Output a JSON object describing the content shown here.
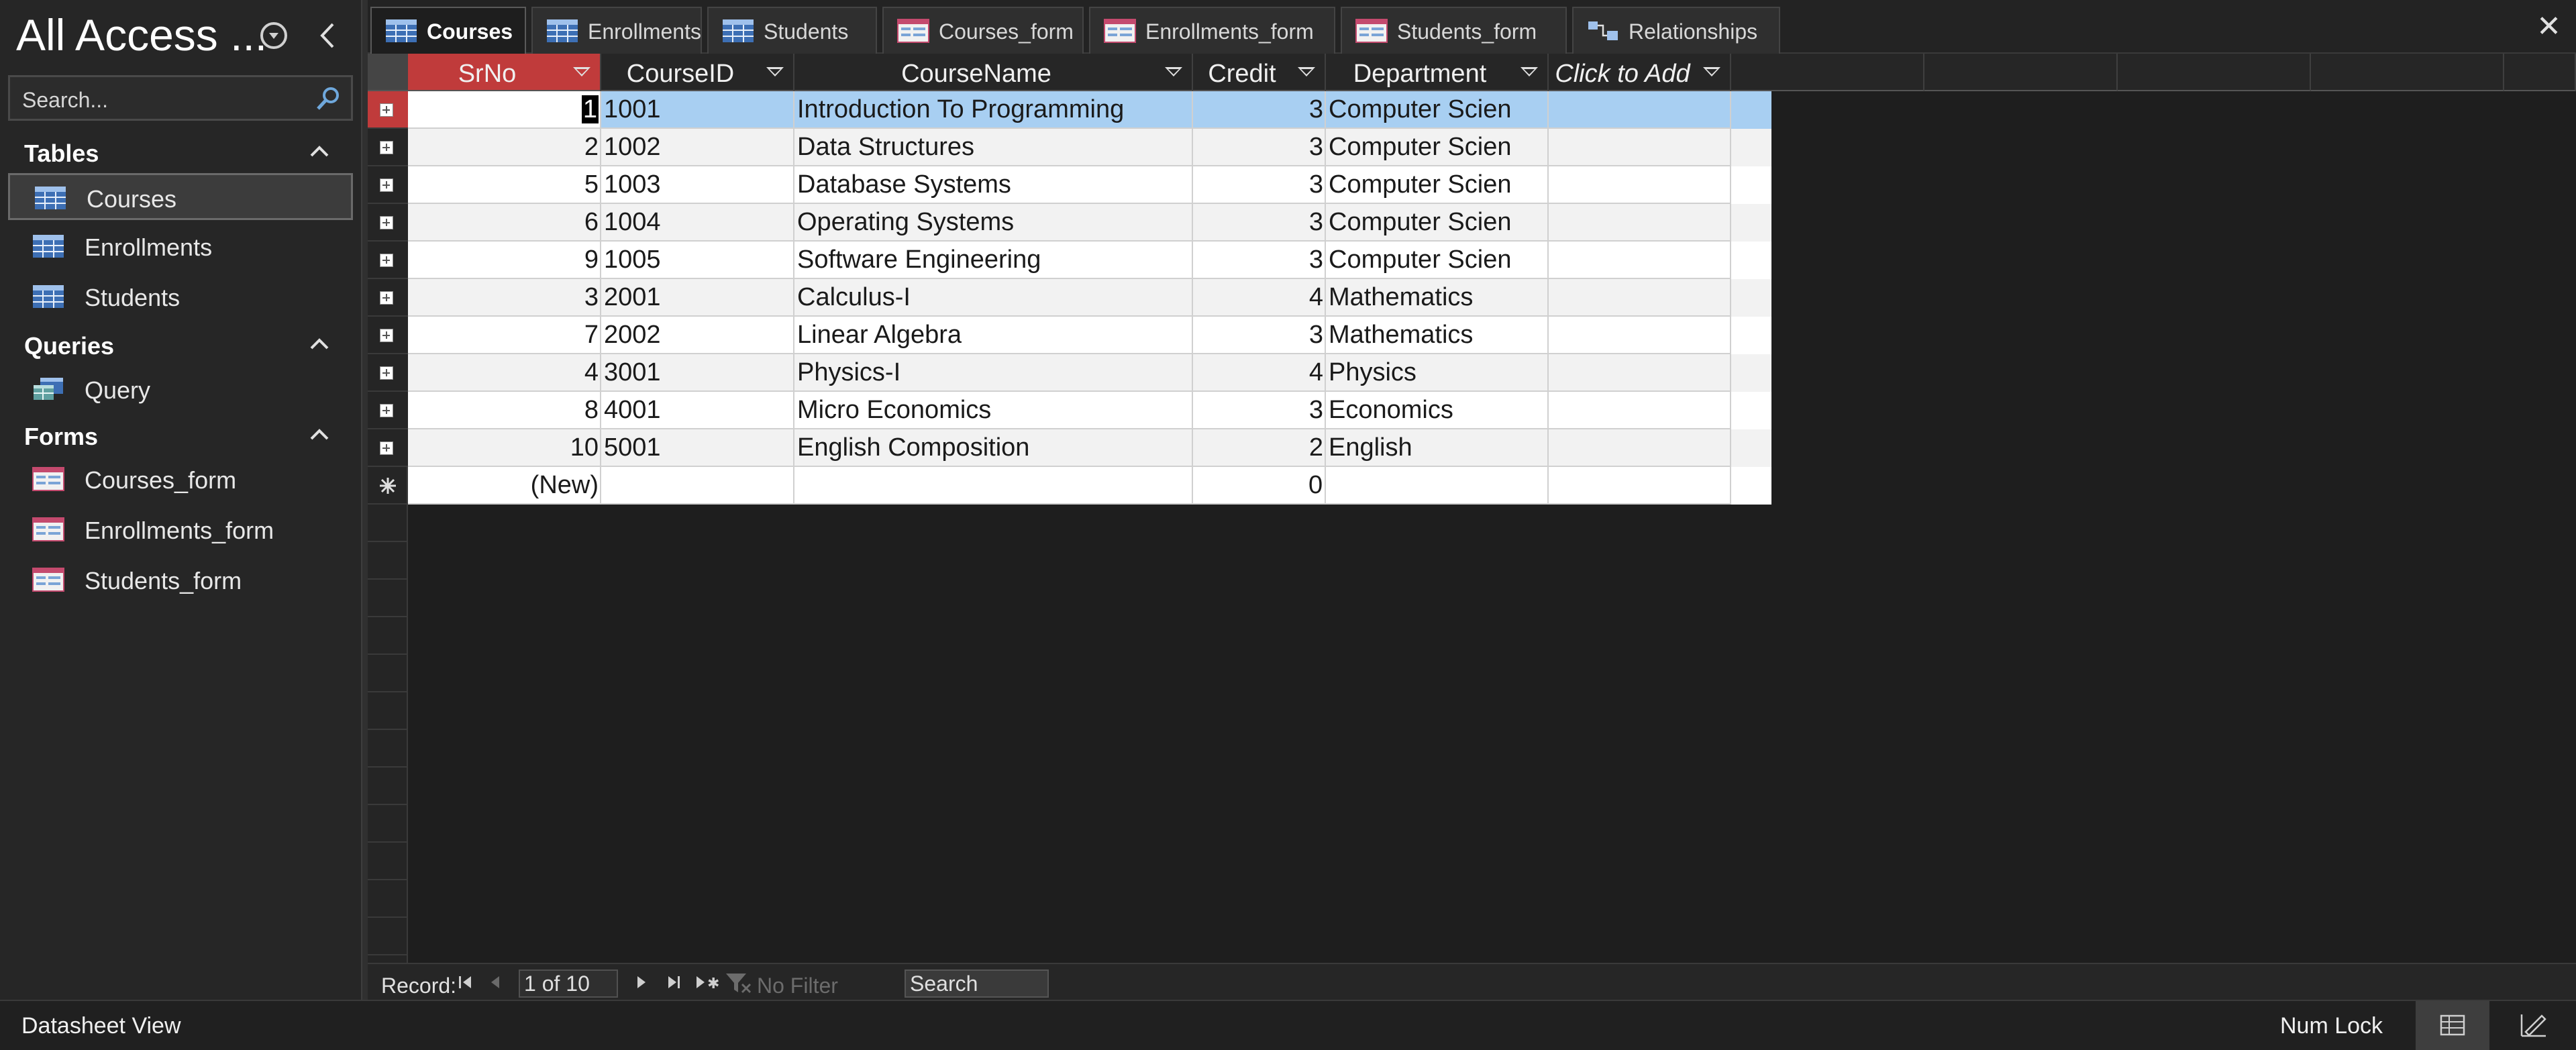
{
  "nav": {
    "title": "All Access ...",
    "search_placeholder": "Search...",
    "groups": [
      {
        "label": "Tables",
        "items": [
          "Courses",
          "Enrollments",
          "Students"
        ]
      },
      {
        "label": "Queries",
        "items": [
          "Query"
        ]
      },
      {
        "label": "Forms",
        "items": [
          "Courses_form",
          "Enrollments_form",
          "Students_form"
        ]
      }
    ],
    "selected_item": "Courses"
  },
  "tabs": [
    {
      "label": "Courses",
      "icon": "table-icon",
      "active": true
    },
    {
      "label": "Enrollments",
      "icon": "table-icon"
    },
    {
      "label": "Students",
      "icon": "table-icon"
    },
    {
      "label": "Courses_form",
      "icon": "form-icon"
    },
    {
      "label": "Enrollments_form",
      "icon": "form-icon"
    },
    {
      "label": "Students_form",
      "icon": "form-icon"
    },
    {
      "label": "Relationships",
      "icon": "relationships-icon"
    }
  ],
  "close_label": "✕",
  "grid": {
    "columns": [
      "SrNo",
      "CourseID",
      "CourseName",
      "Credit",
      "Department",
      "Click to Add"
    ],
    "rows": [
      {
        "srno": "1",
        "courseid": "1001",
        "coursename": "Introduction To Programming",
        "credit": "3",
        "department": "Computer Scien"
      },
      {
        "srno": "2",
        "courseid": "1002",
        "coursename": "Data Structures",
        "credit": "3",
        "department": "Computer Scien"
      },
      {
        "srno": "5",
        "courseid": "1003",
        "coursename": "Database Systems",
        "credit": "3",
        "department": "Computer Scien"
      },
      {
        "srno": "6",
        "courseid": "1004",
        "coursename": "Operating Systems",
        "credit": "3",
        "department": "Computer Scien"
      },
      {
        "srno": "9",
        "courseid": "1005",
        "coursename": "Software Engineering",
        "credit": "3",
        "department": "Computer Scien"
      },
      {
        "srno": "3",
        "courseid": "2001",
        "coursename": "Calculus-I",
        "credit": "4",
        "department": "Mathematics"
      },
      {
        "srno": "7",
        "courseid": "2002",
        "coursename": "Linear Algebra",
        "credit": "3",
        "department": "Mathematics"
      },
      {
        "srno": "4",
        "courseid": "3001",
        "coursename": "Physics-I",
        "credit": "4",
        "department": "Physics"
      },
      {
        "srno": "8",
        "courseid": "4001",
        "coursename": "Micro Economics",
        "credit": "3",
        "department": "Economics"
      },
      {
        "srno": "10",
        "courseid": "5001",
        "coursename": "English Composition",
        "credit": "2",
        "department": "English"
      }
    ],
    "new_row": {
      "srno": "(New)",
      "credit": "0"
    },
    "selected_row_index": 0
  },
  "record_nav": {
    "label": "Record:",
    "position": "1 of 10",
    "filter": "No Filter",
    "search": "Search"
  },
  "status": {
    "view": "Datasheet View",
    "num_lock": "Num Lock"
  },
  "colors": {
    "selected_header": "#c03b3b",
    "selected_row": "#a8cff2",
    "row_alt": "#f2f2f2",
    "row": "#ffffff"
  }
}
